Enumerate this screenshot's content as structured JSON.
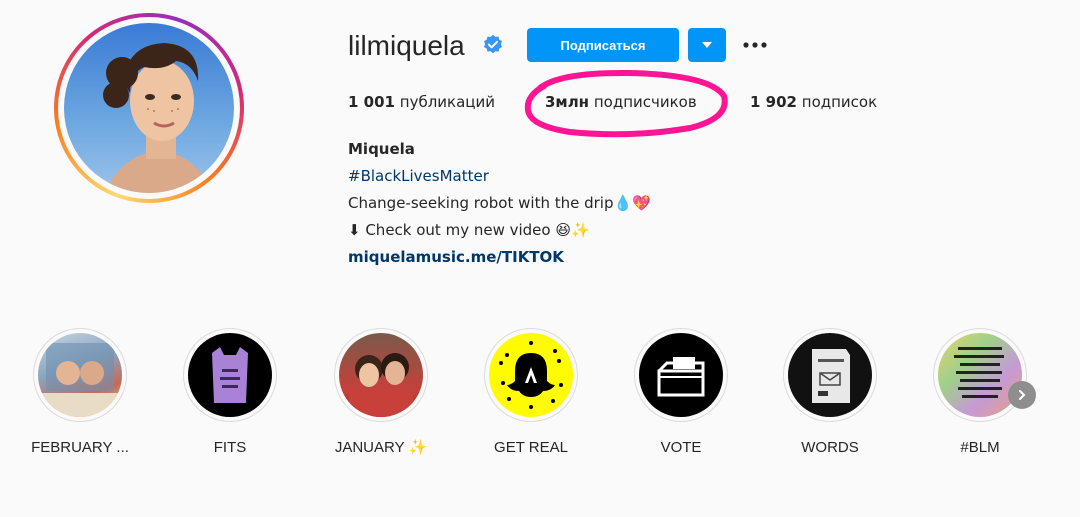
{
  "profile": {
    "username": "lilmiquela",
    "follow_label": "Подписаться",
    "posts": {
      "count": "1 001",
      "label": "публикаций"
    },
    "followers": {
      "count": "3млн",
      "label": "подписчиков"
    },
    "following": {
      "count": "1 902",
      "label": "подписок"
    }
  },
  "bio": {
    "name": "Miquela",
    "hashtag": "#BlackLivesMatter",
    "line1": "Change-seeking robot with the drip💧💖",
    "line2": "⬇ Check out my new video 😆✨",
    "link": "miquelamusic.me/TIKTOK"
  },
  "highlights": [
    {
      "label": "FEBRUARY ..."
    },
    {
      "label": "FITS"
    },
    {
      "label": "JANUARY ✨"
    },
    {
      "label": "GET REAL"
    },
    {
      "label": "VOTE"
    },
    {
      "label": "WORDS"
    },
    {
      "label": "#BLM"
    }
  ],
  "colors": {
    "accent": "#0095f6",
    "link": "#00376b",
    "annotation": "#ff1493"
  },
  "icons": {
    "verified": "verified-badge-icon",
    "dropdown": "chevron-down-icon",
    "more": "more-options-icon",
    "next": "chevron-right-icon"
  }
}
